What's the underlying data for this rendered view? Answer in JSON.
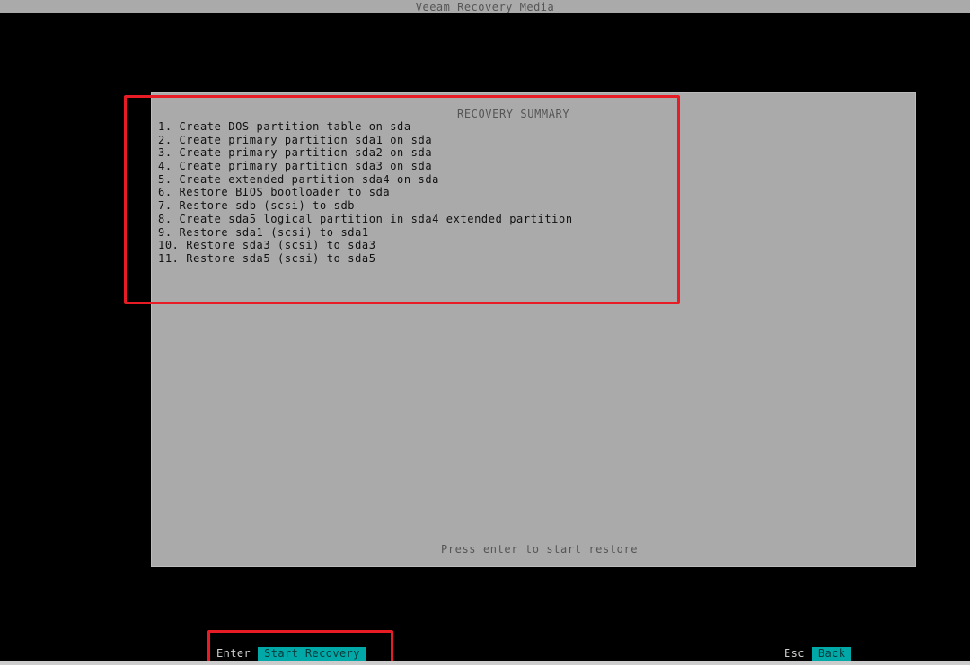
{
  "titlebar": {
    "title": "Veeam Recovery Media"
  },
  "summary": {
    "heading": "RECOVERY SUMMARY",
    "steps": [
      "1. Create DOS partition table on sda",
      "2. Create primary partition sda1 on sda",
      "3. Create primary partition sda2 on sda",
      "4. Create primary partition sda3 on sda",
      "5. Create extended partition sda4 on sda",
      "6. Restore BIOS bootloader to sda",
      "7. Restore sdb (scsi) to sdb",
      "8. Create sda5 logical partition in sda4 extended partition",
      "9. Restore sda1 (scsi) to sda1",
      "10. Restore sda3 (scsi) to sda3",
      "11. Restore sda5 (scsi) to sda5"
    ],
    "footer": "Press enter to start restore"
  },
  "keybar": {
    "enter_key": "Enter",
    "enter_action": "Start Recovery",
    "esc_key": "Esc",
    "esc_action": "Back"
  },
  "colors": {
    "background": "#000000",
    "panel": "#aaaaaa",
    "action_highlight": "#00a8a8",
    "annotation": "#e81c24"
  }
}
